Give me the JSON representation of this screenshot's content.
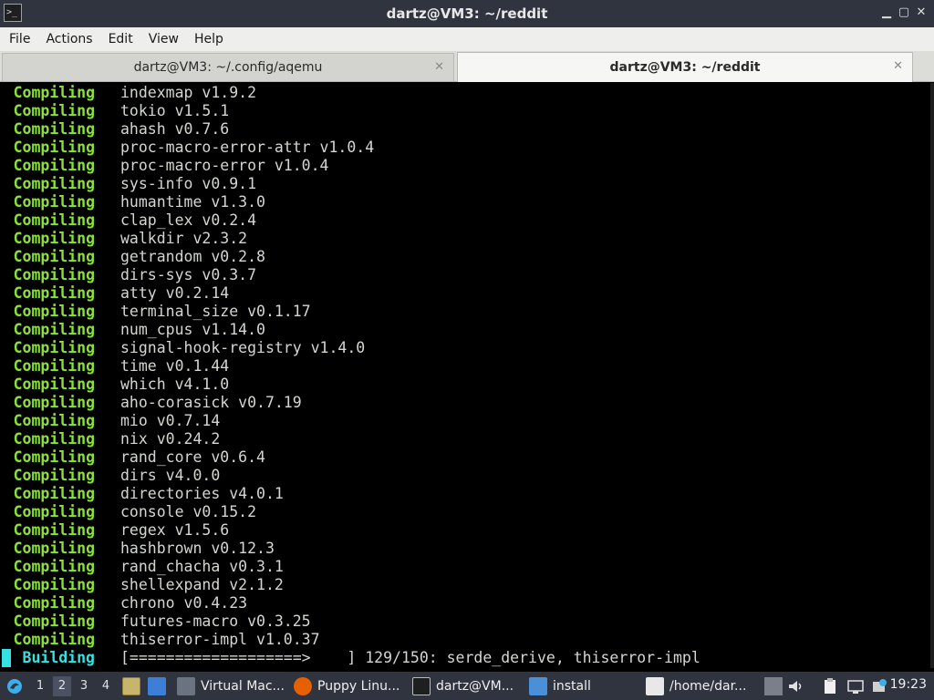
{
  "window": {
    "title": "dartz@VM3: ~/reddit",
    "icon_symbol": ">_",
    "buttons": {
      "minimize": "▁",
      "maximize": "▢",
      "close": "✕"
    }
  },
  "menu": [
    "File",
    "Actions",
    "Edit",
    "View",
    "Help"
  ],
  "tabs": [
    {
      "label": "dartz@VM3: ~/.config/aqemu",
      "active": false,
      "close": "✕"
    },
    {
      "label": "dartz@VM3: ~/reddit",
      "active": true,
      "close": "✕"
    }
  ],
  "terminal": {
    "lines": [
      {
        "keyword": "Compiling",
        "text": "indexmap v1.9.2"
      },
      {
        "keyword": "Compiling",
        "text": "tokio v1.5.1"
      },
      {
        "keyword": "Compiling",
        "text": "ahash v0.7.6"
      },
      {
        "keyword": "Compiling",
        "text": "proc-macro-error-attr v1.0.4"
      },
      {
        "keyword": "Compiling",
        "text": "proc-macro-error v1.0.4"
      },
      {
        "keyword": "Compiling",
        "text": "sys-info v0.9.1"
      },
      {
        "keyword": "Compiling",
        "text": "humantime v1.3.0"
      },
      {
        "keyword": "Compiling",
        "text": "clap_lex v0.2.4"
      },
      {
        "keyword": "Compiling",
        "text": "walkdir v2.3.2"
      },
      {
        "keyword": "Compiling",
        "text": "getrandom v0.2.8"
      },
      {
        "keyword": "Compiling",
        "text": "dirs-sys v0.3.7"
      },
      {
        "keyword": "Compiling",
        "text": "atty v0.2.14"
      },
      {
        "keyword": "Compiling",
        "text": "terminal_size v0.1.17"
      },
      {
        "keyword": "Compiling",
        "text": "num_cpus v1.14.0"
      },
      {
        "keyword": "Compiling",
        "text": "signal-hook-registry v1.4.0"
      },
      {
        "keyword": "Compiling",
        "text": "time v0.1.44"
      },
      {
        "keyword": "Compiling",
        "text": "which v4.1.0"
      },
      {
        "keyword": "Compiling",
        "text": "aho-corasick v0.7.19"
      },
      {
        "keyword": "Compiling",
        "text": "mio v0.7.14"
      },
      {
        "keyword": "Compiling",
        "text": "nix v0.24.2"
      },
      {
        "keyword": "Compiling",
        "text": "rand_core v0.6.4"
      },
      {
        "keyword": "Compiling",
        "text": "dirs v4.0.0"
      },
      {
        "keyword": "Compiling",
        "text": "directories v4.0.1"
      },
      {
        "keyword": "Compiling",
        "text": "console v0.15.2"
      },
      {
        "keyword": "Compiling",
        "text": "regex v1.5.6"
      },
      {
        "keyword": "Compiling",
        "text": "hashbrown v0.12.3"
      },
      {
        "keyword": "Compiling",
        "text": "rand_chacha v0.3.1"
      },
      {
        "keyword": "Compiling",
        "text": "shellexpand v2.1.2"
      },
      {
        "keyword": "Compiling",
        "text": "chrono v0.4.23"
      },
      {
        "keyword": "Compiling",
        "text": "futures-macro v0.3.25"
      },
      {
        "keyword": "Compiling",
        "text": "thiserror-impl v1.0.37"
      }
    ],
    "status": {
      "keyword": "Building",
      "text": "[===================>    ] 129/150: serde_derive, thiserror-impl"
    },
    "colors": {
      "keyword": "#8ae234",
      "status_keyword": "#34e2e2",
      "text": "#d3d7cf",
      "background": "#000000"
    }
  },
  "taskbar": {
    "workspaces": [
      "1",
      "2",
      "3",
      "4"
    ],
    "current_workspace": "2",
    "tasks": [
      {
        "label": "Virtual Mac...",
        "icon": "virtualbox-icon"
      },
      {
        "label": "Puppy Linu...",
        "icon": "firefox-icon"
      },
      {
        "label": "dartz@VM...",
        "icon": "terminal-icon"
      },
      {
        "label": "install",
        "icon": "folder-icon"
      },
      {
        "label": "/home/dar...",
        "icon": "text-editor-icon"
      }
    ],
    "clock": "19:23"
  }
}
